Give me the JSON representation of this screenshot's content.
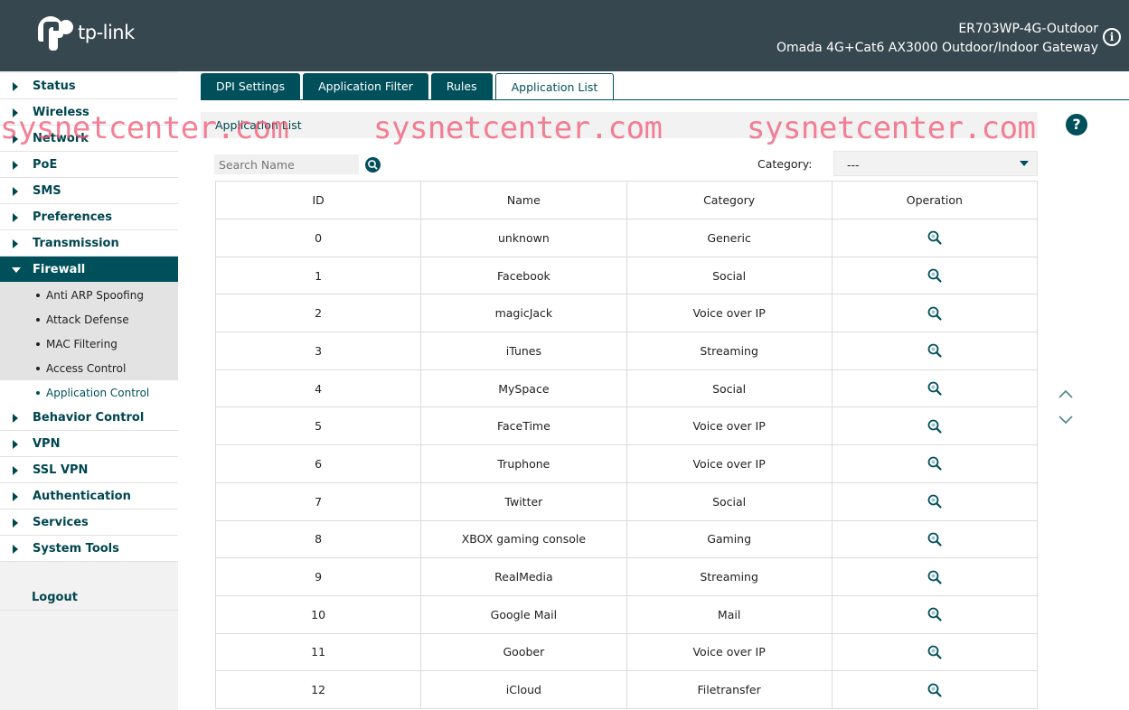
{
  "header": {
    "brand": "tp-link",
    "model": "ER703WP-4G-Outdoor",
    "description": "Omada 4G+Cat6 AX3000 Outdoor/Indoor Gateway",
    "background_color": "#37474f"
  },
  "sidebar": {
    "items": [
      {
        "label": "Status"
      },
      {
        "label": "Wireless"
      },
      {
        "label": "Network"
      },
      {
        "label": "PoE"
      },
      {
        "label": "SMS"
      },
      {
        "label": "Preferences"
      },
      {
        "label": "Transmission"
      },
      {
        "label": "Firewall",
        "expanded": true
      }
    ],
    "firewall_sub": [
      {
        "label": "Anti ARP Spoofing"
      },
      {
        "label": "Attack Defense"
      },
      {
        "label": "MAC Filtering"
      },
      {
        "label": "Access Control"
      },
      {
        "label": "Application Control",
        "active": true
      }
    ],
    "items_after": [
      {
        "label": "Behavior Control"
      },
      {
        "label": "VPN"
      },
      {
        "label": "SSL VPN"
      },
      {
        "label": "Authentication"
      },
      {
        "label": "Services"
      },
      {
        "label": "System Tools"
      }
    ],
    "logout": "Logout",
    "accent_color": "#00505c"
  },
  "tabs": [
    {
      "label": "DPI Settings"
    },
    {
      "label": "Application Filter"
    },
    {
      "label": "Rules"
    },
    {
      "label": "Application List",
      "active": true
    }
  ],
  "main": {
    "section_title": "Application List",
    "search_placeholder": "Search Name",
    "category_label": "Category:",
    "category_value": "---",
    "help_icon": "question-icon",
    "table": {
      "headers": [
        "ID",
        "Name",
        "Category",
        "Operation"
      ],
      "rows": [
        {
          "id": "0",
          "name": "unknown",
          "category": "Generic"
        },
        {
          "id": "1",
          "name": "Facebook",
          "category": "Social"
        },
        {
          "id": "2",
          "name": "magicJack",
          "category": "Voice over IP"
        },
        {
          "id": "3",
          "name": "iTunes",
          "category": "Streaming"
        },
        {
          "id": "4",
          "name": "MySpace",
          "category": "Social"
        },
        {
          "id": "5",
          "name": "FaceTime",
          "category": "Voice over IP"
        },
        {
          "id": "6",
          "name": "Truphone",
          "category": "Voice over IP"
        },
        {
          "id": "7",
          "name": "Twitter",
          "category": "Social"
        },
        {
          "id": "8",
          "name": "XBOX gaming console",
          "category": "Gaming"
        },
        {
          "id": "9",
          "name": "RealMedia",
          "category": "Streaming"
        },
        {
          "id": "10",
          "name": "Google Mail",
          "category": "Mail"
        },
        {
          "id": "11",
          "name": "Goober",
          "category": "Voice over IP"
        },
        {
          "id": "12",
          "name": "iCloud",
          "category": "Filetransfer"
        }
      ],
      "operation_icon": "search-detail-icon"
    }
  },
  "watermark": {
    "text": "sysnetcenter.com",
    "color": "#f0506e"
  }
}
